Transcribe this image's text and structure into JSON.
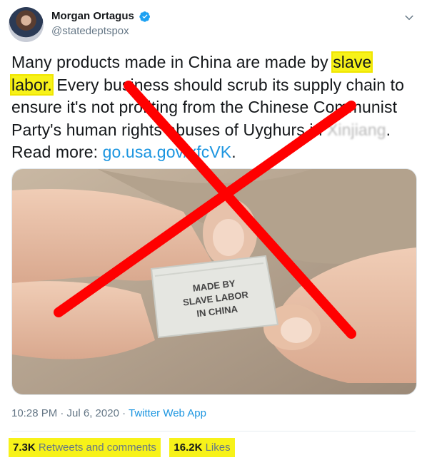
{
  "user": {
    "display_name": "Morgan Ortagus",
    "handle": "@statedeptspox"
  },
  "tweet": {
    "t1": "Many products made in China are made by ",
    "hl1": "slave",
    "hl2": "labor.",
    "t2": " Every business should scrub its supply chain to ensure it's not profiting from the Chinese Communist Party's human rights abuses of Uyghurs in ",
    "t3": "Xinjiang",
    "t4": ". Read more: ",
    "link": "go.usa.gov/xfcVK",
    "t5": "."
  },
  "media": {
    "label_line1": "MADE BY",
    "label_line2": "SLAVE LABOR",
    "label_line3": "IN CHINA"
  },
  "meta": {
    "timestamp": "10:28 PM · Jul 6, 2020 · ",
    "app": "Twitter Web App"
  },
  "stats": {
    "retweets_count": "7.3K",
    "retweets_label": " Retweets and comments",
    "likes_count": "16.2K",
    "likes_label": " Likes"
  },
  "colors": {
    "accent": "#1b95e0",
    "highlight": "#f7f219",
    "cross": "#ff0000"
  },
  "icons": [
    "verified-badge-icon",
    "chevron-down-icon"
  ]
}
